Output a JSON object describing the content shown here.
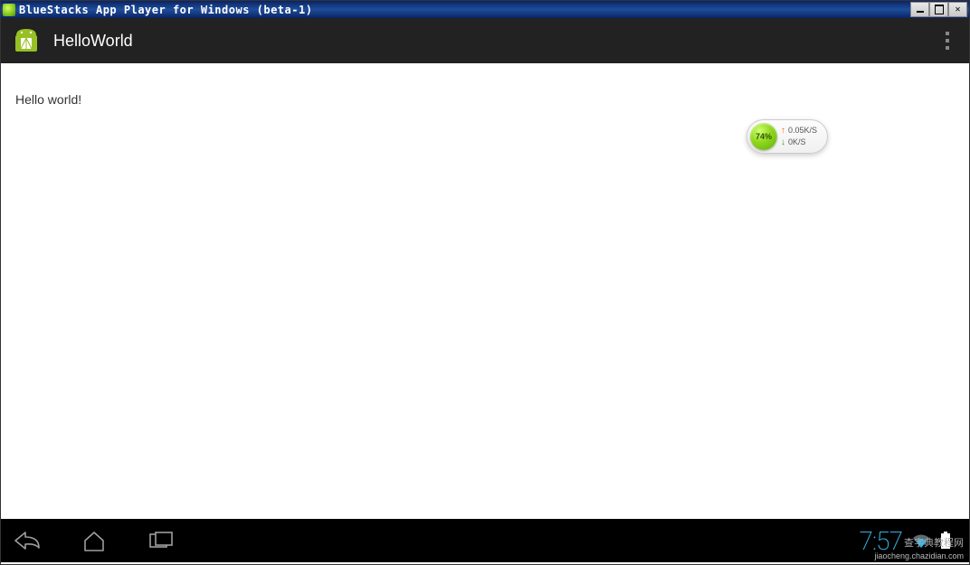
{
  "window": {
    "title": "BlueStacks App Player for Windows (beta-1)"
  },
  "actionBar": {
    "title": "HelloWorld"
  },
  "content": {
    "greeting": "Hello world!"
  },
  "netMonitor": {
    "percent": "74%",
    "upSpeed": "0.05K/S",
    "downSpeed": "0K/S"
  },
  "statusBar": {
    "time": "7:57"
  },
  "watermark": {
    "line1": "查字典教程网",
    "line2": "jiaocheng.chazidian.com"
  },
  "colors": {
    "holoBlue": "#33b5e5",
    "androidGreen": "#a4c639"
  }
}
